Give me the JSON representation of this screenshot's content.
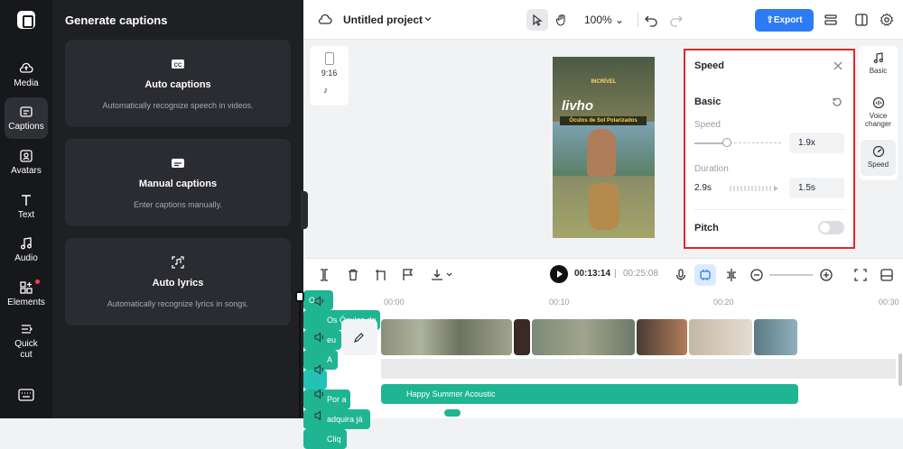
{
  "rail": {
    "items": [
      {
        "label": "Media"
      },
      {
        "label": "Captions"
      },
      {
        "label": "Avatars"
      },
      {
        "label": "Text"
      },
      {
        "label": "Audio"
      },
      {
        "label": "Elements"
      },
      {
        "label": "Quick cut"
      }
    ]
  },
  "captions_panel": {
    "title": "Generate captions",
    "cards": [
      {
        "title": "Auto captions",
        "desc": "Automatically recognize speech in videos."
      },
      {
        "title": "Manual captions",
        "desc": "Enter captions manually."
      },
      {
        "title": "Auto lyrics",
        "desc": "Automatically recognize lyrics in songs."
      }
    ]
  },
  "topbar": {
    "project_title": "Untitled project",
    "zoom": "100%",
    "export_label": "Export"
  },
  "canvas": {
    "ratio": "9:16",
    "preview_small": "INCRÍVEL",
    "preview_big": "livho",
    "preview_band": "Óculos de Sol Polarizados"
  },
  "speed_panel": {
    "title": "Speed",
    "section": "Basic",
    "speed_label": "Speed",
    "speed_value": "1.9x",
    "speed_level": 0.38,
    "duration_label": "Duration",
    "duration_original": "2.9s",
    "duration_value": "1.5s",
    "pitch_label": "Pitch"
  },
  "right_tabs": [
    {
      "label": "Basic"
    },
    {
      "label": "Voice changer"
    },
    {
      "label": "Speed"
    }
  ],
  "timeline": {
    "current_time": "00:13:14",
    "separator": "|",
    "total_time": "00:25:08",
    "ruler": [
      "00:00",
      "00:10",
      "00:20",
      "00:30"
    ],
    "captions": [
      "O",
      "Os Óculos de",
      "eu",
      "A",
      "Por a",
      "adquira já",
      "Cliq"
    ],
    "audio_title": "Happy Summer Acoustic"
  },
  "colors": {
    "accent": "#2d7bf5",
    "caption_track": "#1fb592",
    "highlight": "#e02828"
  }
}
